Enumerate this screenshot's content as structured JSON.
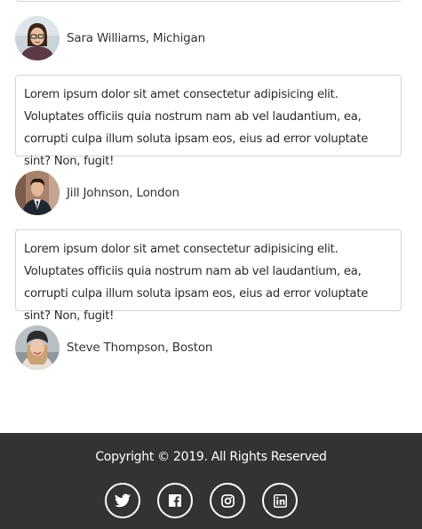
{
  "testimonials": [
    {
      "author": "Sara Williams, Michigan",
      "text": "Lorem ipsum dolor sit amet consectetur adipisicing elit. Voluptates officiis quia nostrum nam ab vel laudantium, ea, corrupti culpa illum soluta ipsam eos, eius ad error voluptate sint? Non, fugit!"
    },
    {
      "author": "Jill Johnson, London",
      "text": "Lorem ipsum dolor sit amet consectetur adipisicing elit. Voluptates officiis quia nostrum nam ab vel laudantium, ea, corrupti culpa illum soluta ipsam eos, eius ad error voluptate sint? Non, fugit!"
    },
    {
      "author": "Steve Thompson, Boston"
    }
  ],
  "footer": {
    "copyright": "Copyright © 2019. All Rights Reserved",
    "social_icons": [
      "twitter-icon",
      "facebook-icon",
      "instagram-icon",
      "linkedin-icon"
    ]
  },
  "colors": {
    "footer_background": "#333333",
    "footer_text": "#ffffff",
    "card_border": "#d4d4d4"
  }
}
